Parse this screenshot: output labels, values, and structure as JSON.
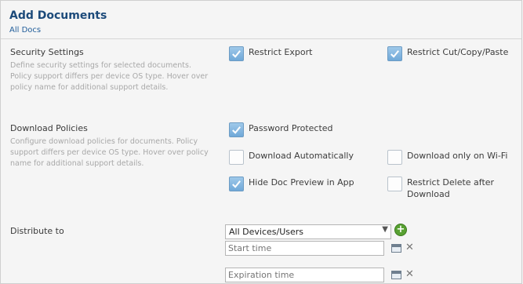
{
  "header": {
    "title": "Add Documents",
    "breadcrumb": "All Docs"
  },
  "security": {
    "label": "Security Settings",
    "description": "Define security settings for selected documents. Policy support differs per device OS type. Hover over policy name for additional support details.",
    "options": [
      {
        "label": "Restrict Export",
        "checked": true
      },
      {
        "label": "Restrict Cut/Copy/Paste",
        "checked": true
      }
    ]
  },
  "download": {
    "label": "Download Policies",
    "description": "Configure download policies for documents. Policy support differs per device OS type. Hover over policy name for additional support details.",
    "options": [
      {
        "label": "Password Protected",
        "checked": true
      },
      {
        "label": "Download Automatically",
        "checked": false
      },
      {
        "label": "Download only on Wi-Fi",
        "checked": false
      },
      {
        "label": "Hide Doc Preview in App",
        "checked": true
      },
      {
        "label": "Restrict Delete after Download",
        "checked": false
      }
    ]
  },
  "distribute": {
    "label": "Distribute to",
    "selected": "All Devices/Users",
    "start_placeholder": "Start time",
    "expiration_placeholder": "Expiration time"
  }
}
